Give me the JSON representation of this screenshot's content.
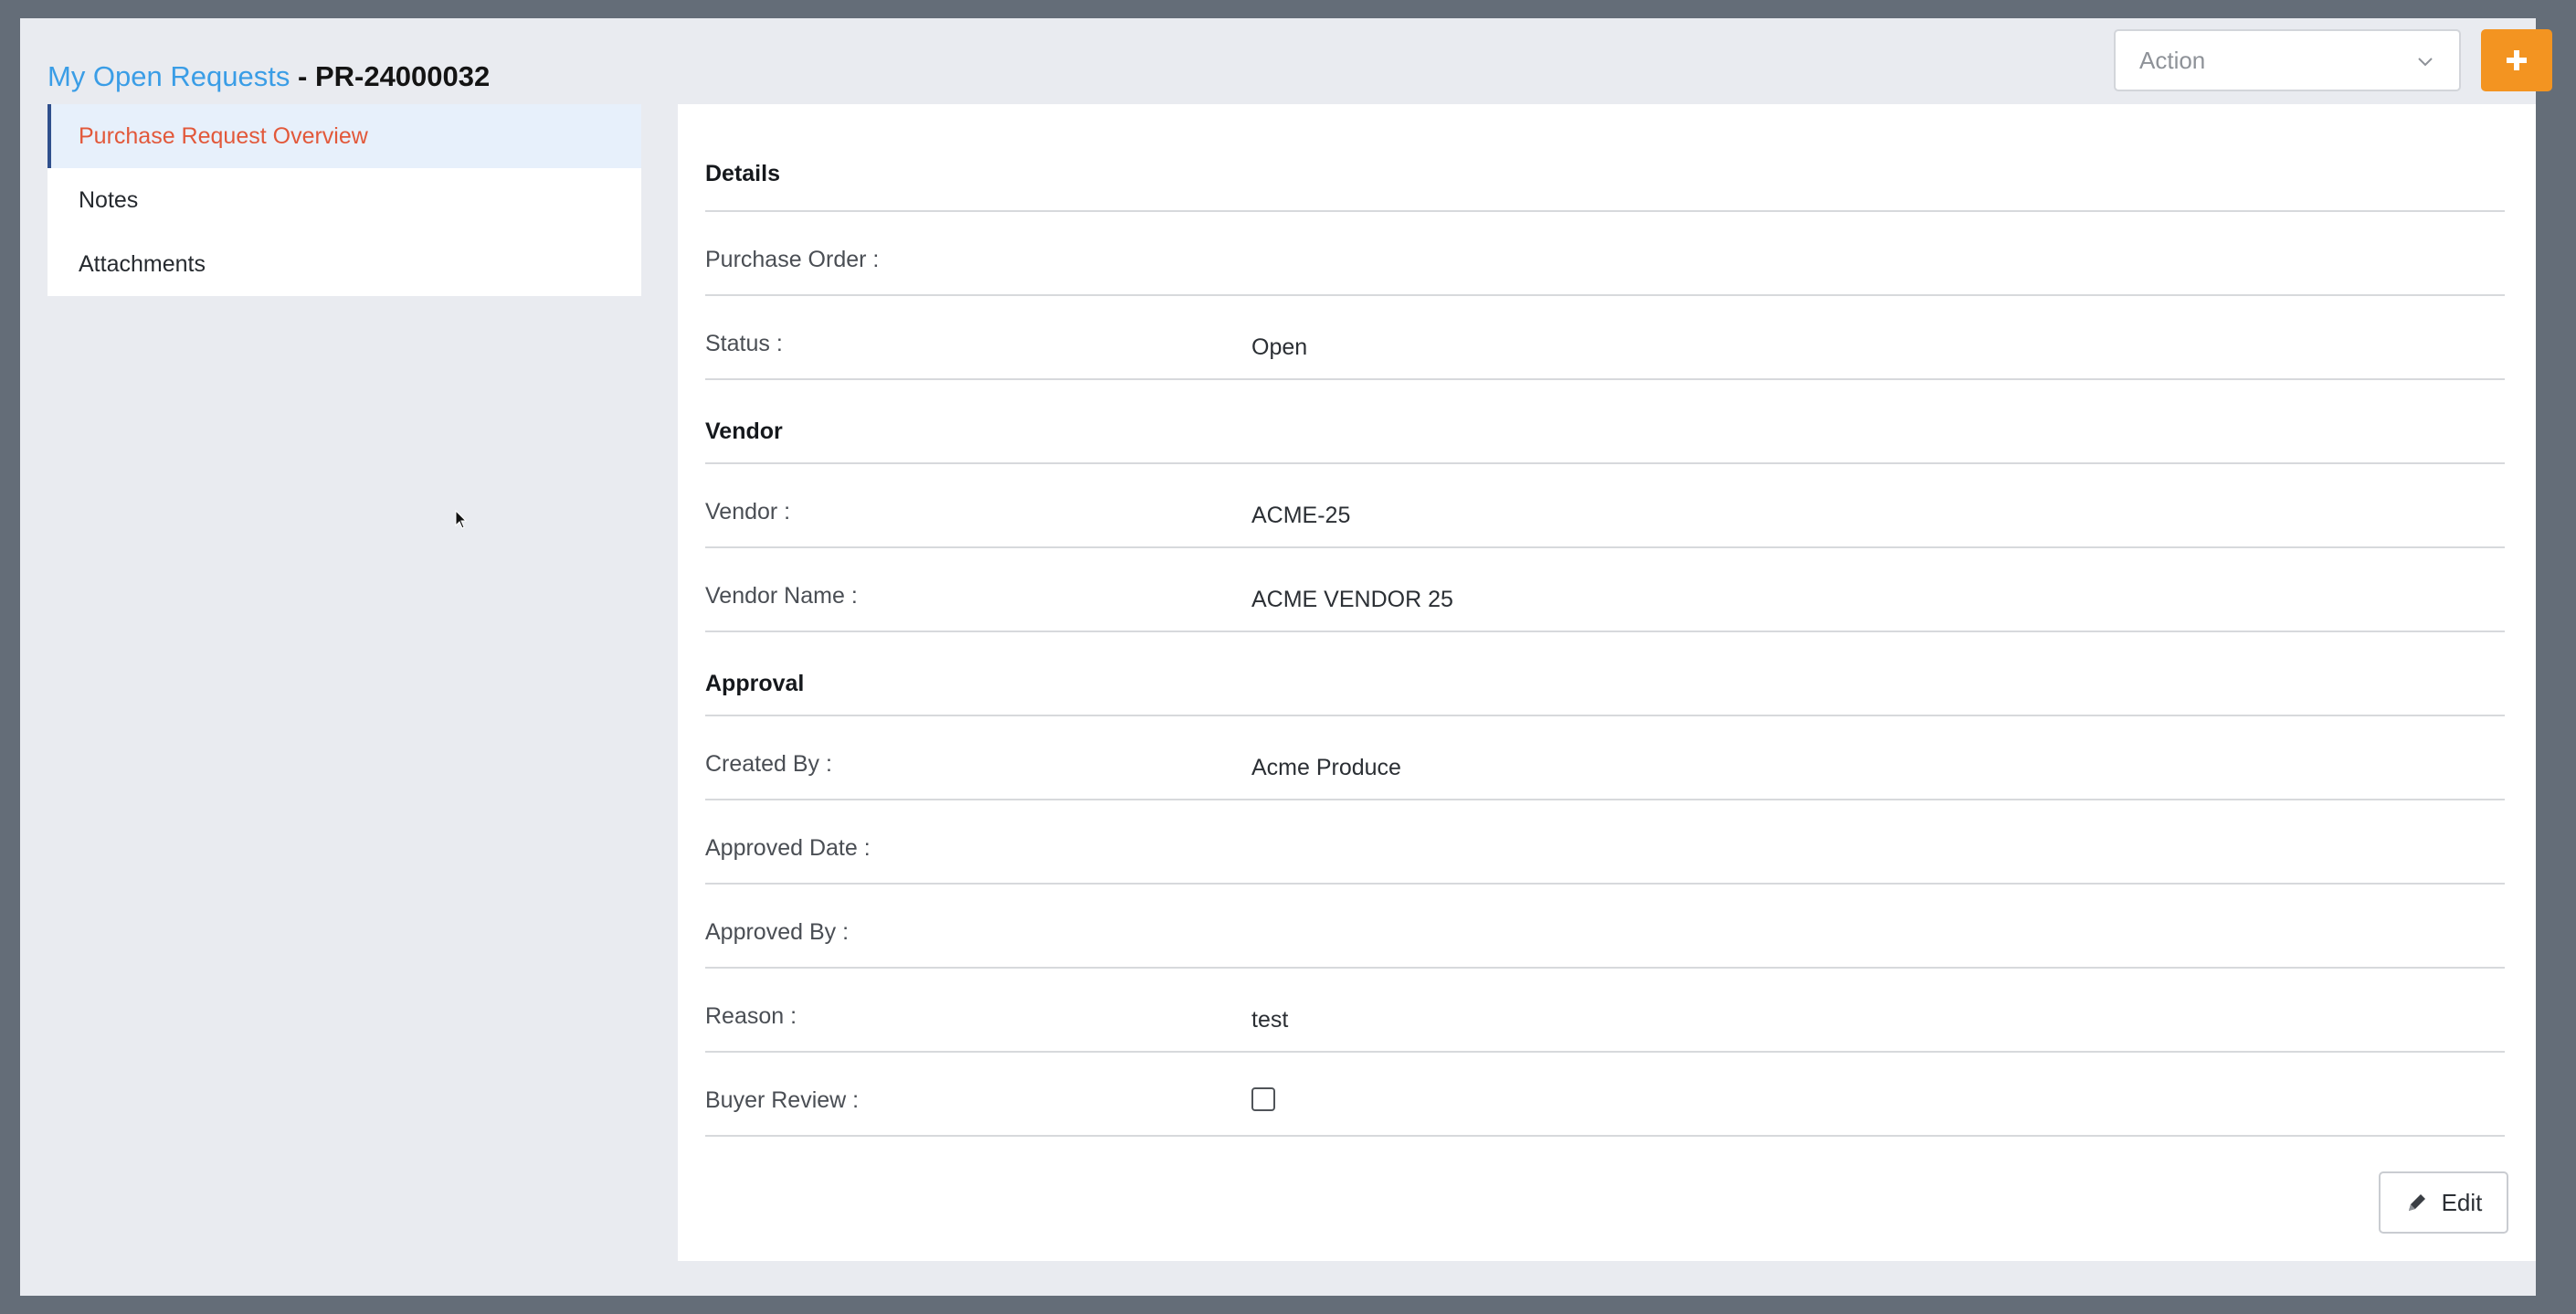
{
  "header": {
    "breadcrumb": "My Open Requests",
    "separator": "-",
    "request_id": "PR-24000032",
    "action_select": {
      "value": "Action",
      "icon": "chevron-down-icon"
    },
    "add_button": {
      "icon": "plus-icon"
    }
  },
  "sidebar": {
    "items": [
      {
        "label": "Purchase Request Overview",
        "active": true
      },
      {
        "label": "Notes",
        "active": false
      },
      {
        "label": "Attachments",
        "active": false
      }
    ]
  },
  "details": {
    "sections": {
      "details": "Details",
      "vendor": "Vendor",
      "approval": "Approval"
    },
    "fields": {
      "purchase_order": {
        "label": "Purchase Order :",
        "value": ""
      },
      "status": {
        "label": "Status :",
        "value": "Open"
      },
      "vendor": {
        "label": "Vendor :",
        "value": "ACME-25"
      },
      "vendor_name": {
        "label": "Vendor Name :",
        "value": "ACME VENDOR 25"
      },
      "created_by": {
        "label": "Created By :",
        "value": "Acme Produce"
      },
      "approved_date": {
        "label": "Approved Date :",
        "value": ""
      },
      "approved_by": {
        "label": "Approved By :",
        "value": ""
      },
      "reason": {
        "label": "Reason :",
        "value": "test"
      },
      "buyer_review": {
        "label": "Buyer Review :",
        "checked": false
      }
    },
    "edit_button": {
      "label": "Edit",
      "icon": "pencil-icon"
    }
  },
  "colors": {
    "accent_link": "#3a9de6",
    "active_item_text": "#e2583a",
    "add_button": "#f39421",
    "active_item_bg": "#e7f0fb"
  }
}
